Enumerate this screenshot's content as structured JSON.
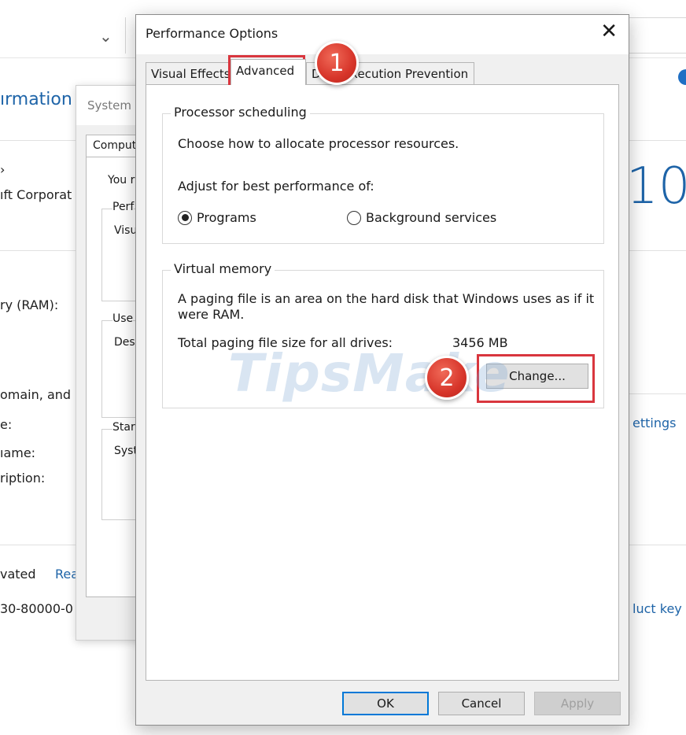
{
  "background_window": {
    "title_partial": "ırmation",
    "left_texts": [
      "›",
      "ıft Corporat",
      "ry (RAM):",
      "omain, and",
      "e:",
      "ıame:",
      "ription:",
      "vated"
    ],
    "activation_link": "Rea",
    "product_id_partial": "30-80000-0",
    "windows_version": "10",
    "change_settings_partial": "ettings",
    "product_key_partial": "luct key"
  },
  "system_properties": {
    "title_partial": "System",
    "tab_partial": "Comput",
    "lines": [
      "You r",
      "Perf",
      "Visu",
      "Use",
      "Des",
      "Star",
      "Syst"
    ]
  },
  "performance_options": {
    "title": "Performance Options",
    "close_glyph": "✕",
    "tabs": [
      {
        "label": "Visual Effects"
      },
      {
        "label": "Advanced"
      },
      {
        "label": "Data Execution Prevention"
      }
    ],
    "processor_scheduling": {
      "title": "Processor scheduling",
      "description": "Choose how to allocate processor resources.",
      "adjust_label": "Adjust for best performance of:",
      "options": [
        {
          "label": "Programs",
          "selected": true
        },
        {
          "label": "Background services",
          "selected": false
        }
      ]
    },
    "virtual_memory": {
      "title": "Virtual memory",
      "description": "A paging file is an area on the hard disk that Windows uses as if it were RAM.",
      "total_label": "Total paging file size for all drives:",
      "total_value": "3456 MB",
      "change_button": "Change..."
    },
    "buttons": {
      "ok": "OK",
      "cancel": "Cancel",
      "apply": "Apply"
    }
  },
  "annotations": {
    "step1": "1",
    "step2": "2",
    "highlight_color": "#d9363e",
    "watermark": "TipsMake"
  }
}
